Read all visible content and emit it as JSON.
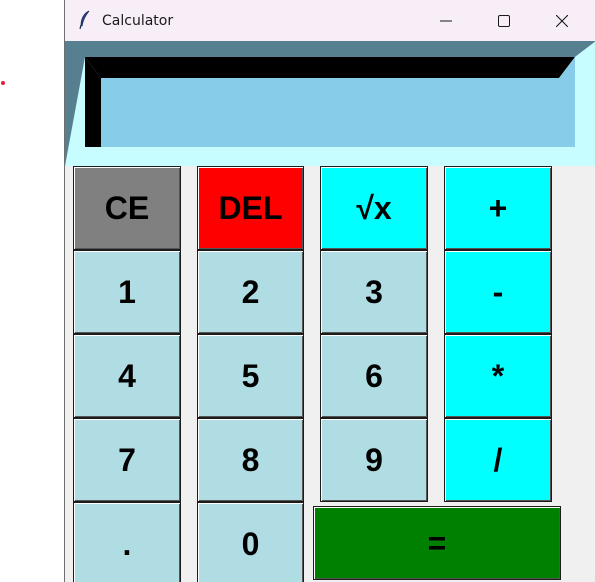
{
  "window": {
    "title": "Calculator",
    "icon": "feather-icon",
    "controls": [
      "minimize-icon",
      "maximize-icon",
      "close-icon"
    ]
  },
  "display": {
    "value": "",
    "background": "#87cdea",
    "frame_color": "#c8fdff",
    "bevel_color": "#56808f"
  },
  "keypad": {
    "ce": "CE",
    "del": "DEL",
    "sqrt": "√x",
    "plus": "+",
    "minus": "-",
    "multiply": "*",
    "divide": "/",
    "equals": "=",
    "decimal": ".",
    "digits": {
      "d0": "0",
      "d1": "1",
      "d2": "2",
      "d3": "3",
      "d4": "4",
      "d5": "5",
      "d6": "6",
      "d7": "7",
      "d8": "8",
      "d9": "9"
    }
  },
  "colors": {
    "digit_button": "#b0dde3",
    "operator_button": "#00ffff",
    "ce_button": "#808080",
    "del_button": "#ff0000",
    "equals_button": "#008000",
    "titlebar": "#f8eef7"
  }
}
